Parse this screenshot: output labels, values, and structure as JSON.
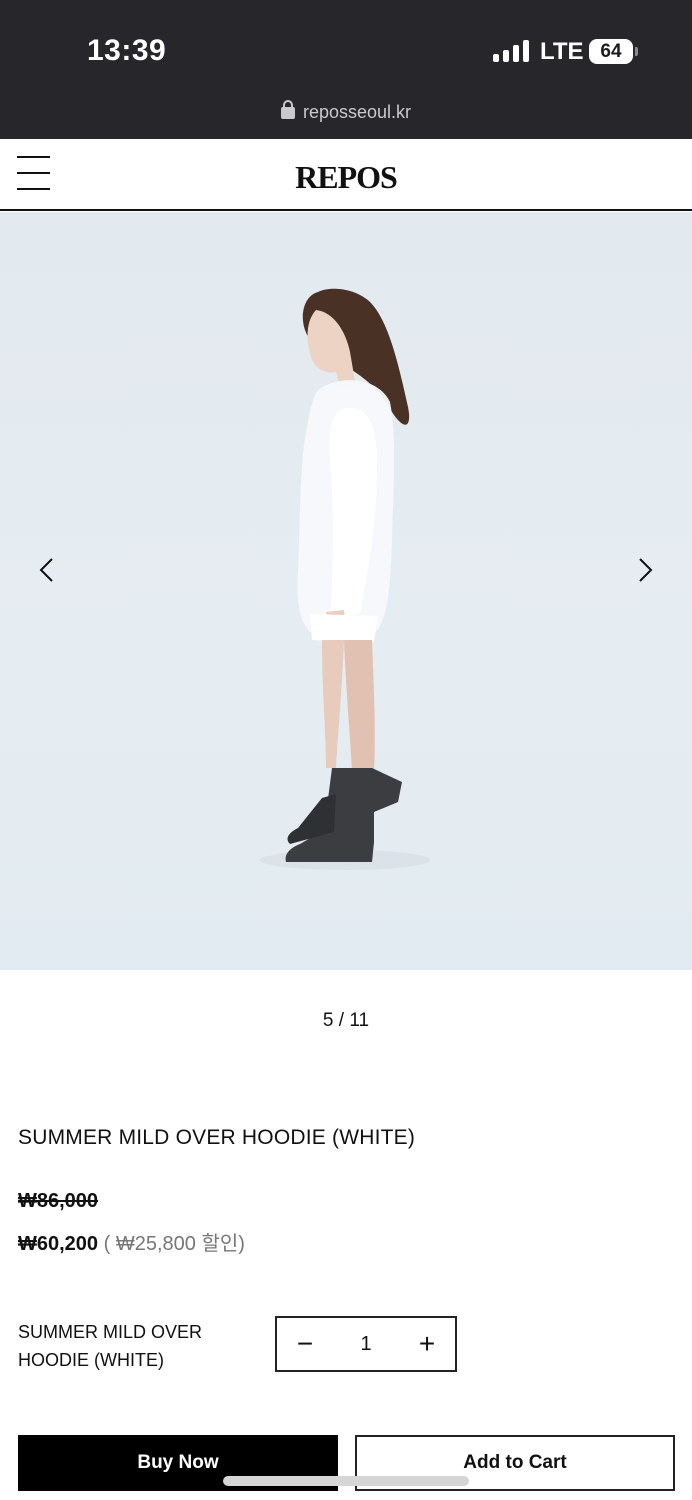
{
  "status_bar": {
    "time": "13:39",
    "network": "LTE",
    "battery": "64",
    "url": "reposseoul.kr"
  },
  "header": {
    "logo": "REPOS"
  },
  "gallery": {
    "counter": "5 / 11",
    "background_color": "#e4ebf1"
  },
  "product": {
    "title": "SUMMER MILD OVER HOODIE (WHITE)",
    "original_price": "₩86,000",
    "sale_price": "₩60,200",
    "discount_text": " ( ₩25,800 할인)"
  },
  "option": {
    "name": "SUMMER MILD OVER HOODIE (WHITE)",
    "quantity": "1",
    "minus_symbol": "−",
    "plus_symbol": "+"
  },
  "actions": {
    "buy_now": "Buy Now",
    "add_to_cart": "Add to Cart"
  }
}
